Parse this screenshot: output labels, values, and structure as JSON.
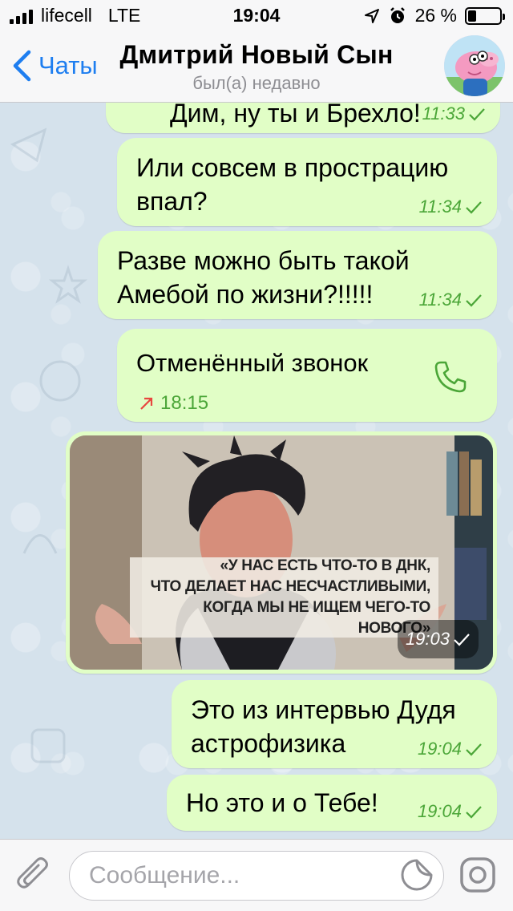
{
  "status_bar": {
    "carrier": "lifecell",
    "network": "LTE",
    "time": "19:04",
    "battery_text": "26 %",
    "battery_level": 0.26,
    "signal_bars": 4
  },
  "header": {
    "back_label": "Чаты",
    "title": "Дмитрий Новый Сын",
    "subtitle": "был(а) недавно"
  },
  "messages": [
    {
      "text": "Дим, ну ты и Брехло!",
      "time": "11:33"
    },
    {
      "text": "Или совсем в прострацию\nвпал?",
      "time": "11:34"
    },
    {
      "text": "Разве можно быть такой\nАмебой по жизни?!!!!!",
      "time": "11:34"
    },
    {
      "call_title": "Отменённый звонок",
      "call_time": "18:15"
    },
    {
      "photo_caption": [
        "«У НАС ЕСТЬ ЧТО-ТО В ДНК,",
        "ЧТО ДЕЛАЕТ НАС НЕСЧАСТЛИВЫМИ,",
        "КОГДА МЫ НЕ ИЩЕМ ЧЕГО-ТО НОВОГО»"
      ],
      "time": "19:03"
    },
    {
      "text": "Это из интервью Дудя\nастрофизика",
      "time": "19:04"
    },
    {
      "text": "Но это и о Тебе!",
      "time": "19:04"
    }
  ],
  "input": {
    "placeholder": "Сообщение..."
  },
  "colors": {
    "bubble": "#e1fec6",
    "time_green": "#4ba638",
    "accent_blue": "#1e7ef0",
    "missed_call_red": "#e8473f"
  },
  "icons": {
    "back": "chevron-left-icon",
    "attach": "paperclip-icon",
    "sticker": "sticker-icon",
    "camera": "camera-icon",
    "call": "phone-icon",
    "outgoing": "arrow-up-right-icon",
    "read": "check-icon"
  }
}
